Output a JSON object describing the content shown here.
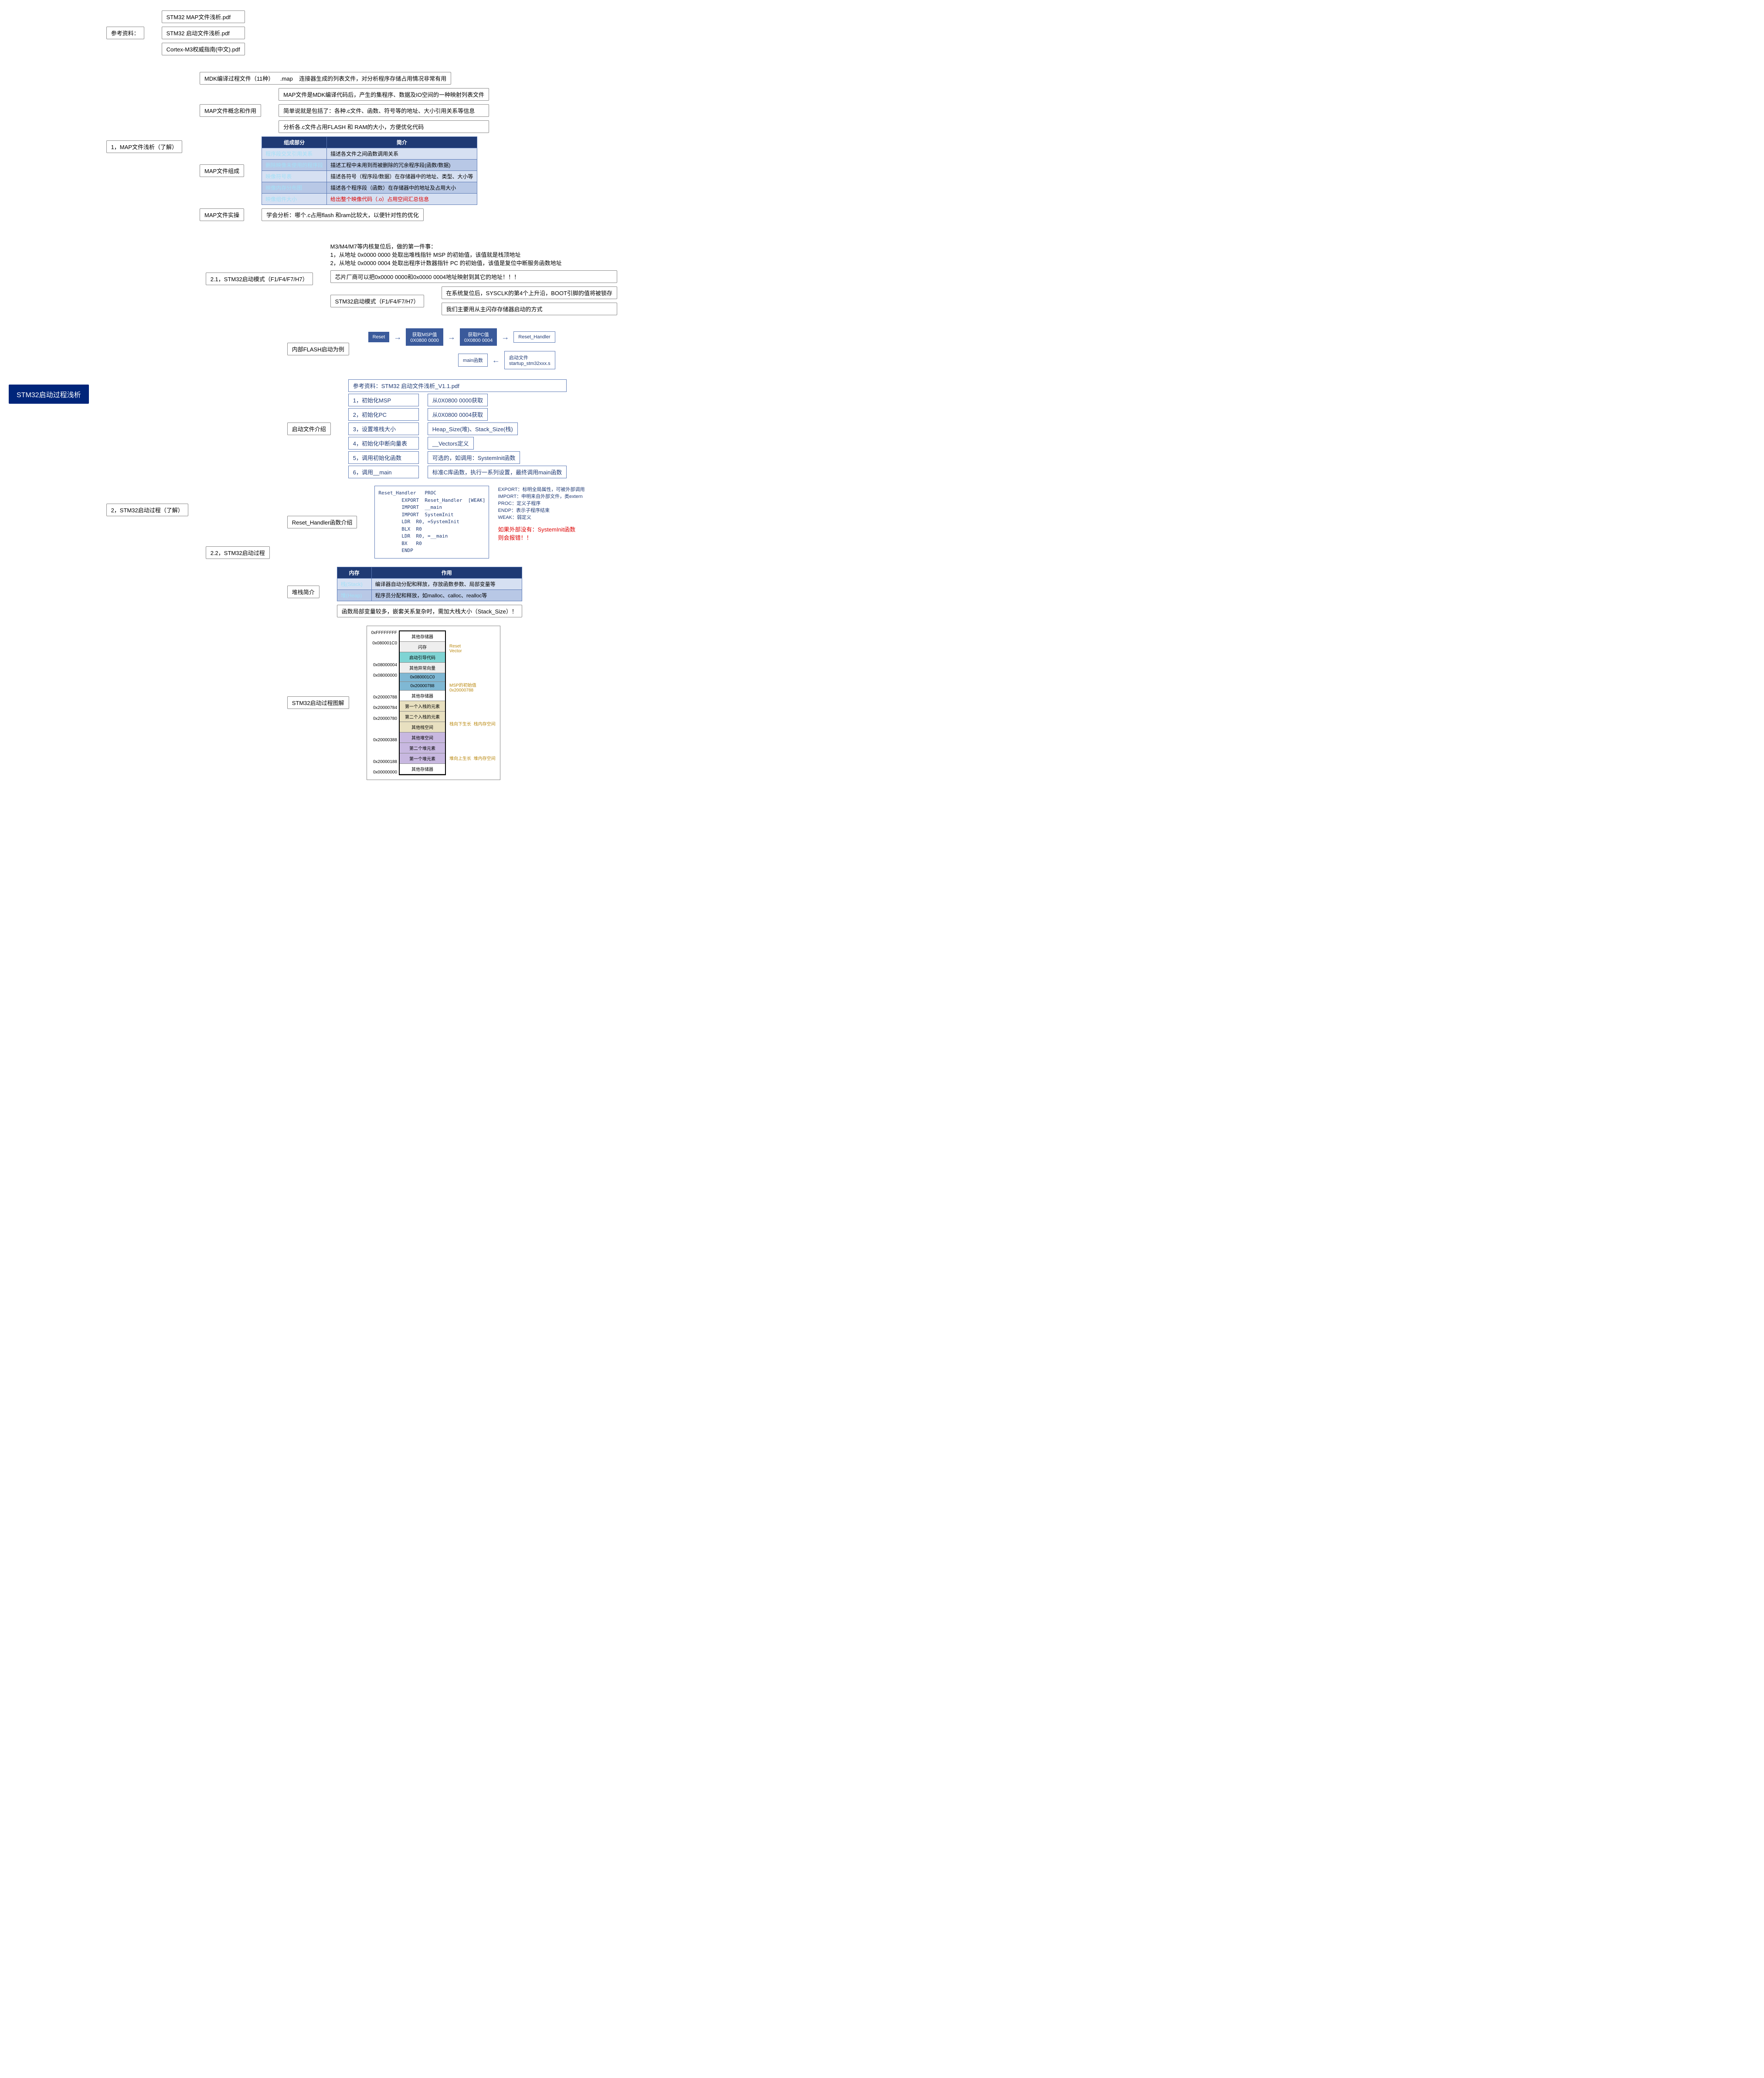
{
  "root": "STM32启动过程浅析",
  "refs": {
    "label": "参考资料：",
    "files": [
      "STM32 MAP文件浅析.pdf",
      "STM32 启动文件浅析.pdf",
      "Cortex-M3权威指南(中文).pdf"
    ]
  },
  "map": {
    "title": "1，MAP文件浅析（了解）",
    "mdk": {
      "label": "MDK编译过程文件（11种）",
      "ext": ".map",
      "desc": "连接器生成的列表文件，对分析程序存储占用情况非常有用"
    },
    "overview": {
      "label": "MAP文件概念和作用",
      "lines": [
        "MAP文件是MDK编译代码后，产生的集程序、数据及IO空间的一种映射列表文件",
        "简单说就是包括了：各种.c文件、函数、符号等的地址、大小引用关系等信息",
        "分析各.c文件占用FLASH 和 RAM的大小，方便优化代码"
      ]
    },
    "compose": {
      "label": "MAP文件组成",
      "th": [
        "组成部分",
        "简介"
      ],
      "rows": [
        [
          "程序段交叉引用关系",
          "描述各文件之间函数调用关系"
        ],
        [
          "删除映像未使用的程序段",
          "描述工程中未用到而被删除的冗余程序段(函数/数据)"
        ],
        [
          "映像符号表",
          "描述各符号（程序段/数据）在存储器中的地址、类型、大小等"
        ],
        [
          "映像内存分布图",
          "描述各个程序段（函数）在存储器中的地址及占用大小"
        ],
        [
          "映像组件大小",
          "给出整个映像代码（.o）占用空间汇总信息"
        ]
      ]
    },
    "practice": {
      "label": "MAP文件实操",
      "desc": "学会分析：哪个.c占用flash 和ram比较大，以便针对性的优化"
    }
  },
  "boot": {
    "title": "2，STM32启动过程（了解）",
    "mode": {
      "label": "2.1，STM32启动模式（F1/F4/F7/H7）",
      "intro": [
        "M3/M4/M7等内核复位后，做的第一件事：",
        "1，从地址 0x0000 0000 处取出堆栈指针 MSP 的初始值，该值就是栈顶地址",
        "2，从地址 0x0000 0004 处取出程序计数器指针 PC 的初始值，该值是复位中断服务函数地址"
      ],
      "chip": "芯片厂商可以把0x0000 0000和0x0000 0004地址映射到其它的地址！！！",
      "sub": {
        "label": "STM32启动模式（F1/F4/F7/H7）",
        "lines": [
          "在系统复位后，SYSCLK的第4个上升沿，BOOT引脚的值将被锁存",
          "我们主要用从主闪存存储器启动的方式"
        ]
      }
    },
    "process": {
      "label": "2.2，STM32启动过程",
      "flash": {
        "label": "内部FLASH启动为例",
        "flow": [
          {
            "t": "dbox",
            "text": "Reset"
          },
          {
            "t": "dbox",
            "text": "获取MSP值\n0X0800 0000"
          },
          {
            "t": "dbox",
            "text": "获取PC值\n0X0800 0004"
          },
          {
            "t": "lbox",
            "text": "Reset_Handler"
          },
          {
            "t": "lbox",
            "text": "启动文件\nstartup_stm32xxx.s"
          },
          {
            "t": "lbox",
            "text": "main函数"
          }
        ]
      },
      "startfile": {
        "label": "启动文件介绍",
        "ref": "参考资料：STM32 启动文件浅析_V1.1.pdf",
        "steps": [
          [
            "1，初始化MSP",
            "从0X0800 0000获取"
          ],
          [
            "2，初始化PC",
            "从0X0800 0004获取"
          ],
          [
            "3，设置堆栈大小",
            "Heap_Size(堆)、Stack_Size(栈)"
          ],
          [
            "4，初始化中断向量表",
            "__Vectors定义"
          ],
          [
            "5，调用初始化函数",
            "可选的，如调用：SystemInit函数"
          ],
          [
            "6，调用__main",
            "标准C库函数，执行一系列设置，最终调用main函数"
          ]
        ]
      },
      "reset": {
        "label": "Reset_Handler函数介绍",
        "code": "Reset_Handler   PROC\n        EXPORT  Reset_Handler  [WEAK]\n        IMPORT  __main\n        IMPORT  SystemInit\n        LDR  R0, =SystemInit\n        BLX  R0\n        LDR  R0, =__main\n        BX   R0\n        ENDP",
        "notes": [
          "EXPORT：标明全局属性，可被外部调用",
          "IMPORT：申明来自外部文件，类extern",
          "PROC：定义子程序",
          "ENDP：表示子程序结束",
          "WEAK：弱定义"
        ],
        "warn": "如果外部没有：SystemInit函数\n则会报错！！"
      },
      "stack": {
        "label": "堆栈简介",
        "th": [
          "内存",
          "作用"
        ],
        "rows": [
          [
            "栈(Stack)",
            "编译器自动分配和释放，存放函数参数、局部变量等"
          ],
          [
            "堆(Heap)",
            "程序员分配和释放，如malloc、calloc、realloc等"
          ]
        ],
        "note": "函数局部变量较多，嵌套关系复杂时，需加大栈大小（Stack_Size）！"
      },
      "diagram": {
        "label": "STM32启动过程图解",
        "addrs": [
          "0xFFFFFFFF",
          "0x080001C0",
          "",
          "0x08000004",
          "0x08000000",
          "",
          "0x20000788",
          "0x20000784",
          "0x20000780",
          "",
          "0x20000388",
          "",
          "0x20000188",
          "0x00000000"
        ],
        "blocks": [
          {
            "t": "其他存储器",
            "c": "#fff"
          },
          {
            "t": "闪存",
            "c": "#eee"
          },
          {
            "t": "启动引导代码",
            "c": "#7FD4D4"
          },
          {
            "t": "其他异常向量",
            "c": "#eee"
          },
          {
            "t": "0x080001C0",
            "c": "#7FB8D4"
          },
          {
            "t": "0x20000788",
            "c": "#7FB8D4"
          },
          {
            "t": "其他存储器",
            "c": "#fff"
          },
          {
            "t": "第一个入栈的元素",
            "c": "#E8E0C0"
          },
          {
            "t": "第二个入栈的元素",
            "c": "#E8E0C0"
          },
          {
            "t": "其他栈空间",
            "c": "#E8E0C0"
          },
          {
            "t": "其他堆空间",
            "c": "#C8B8E0"
          },
          {
            "t": "第二个堆元素",
            "c": "#C8B8E0"
          },
          {
            "t": "第一个堆元素",
            "c": "#C8B8E0"
          },
          {
            "t": "其他存储器",
            "c": "#fff"
          }
        ],
        "notes": [
          "Reset\nVector",
          "MSP的初始值\n0x20000788",
          "栈向下生长  栈内存空间",
          "堆向上生长  堆内存空间"
        ]
      }
    }
  }
}
